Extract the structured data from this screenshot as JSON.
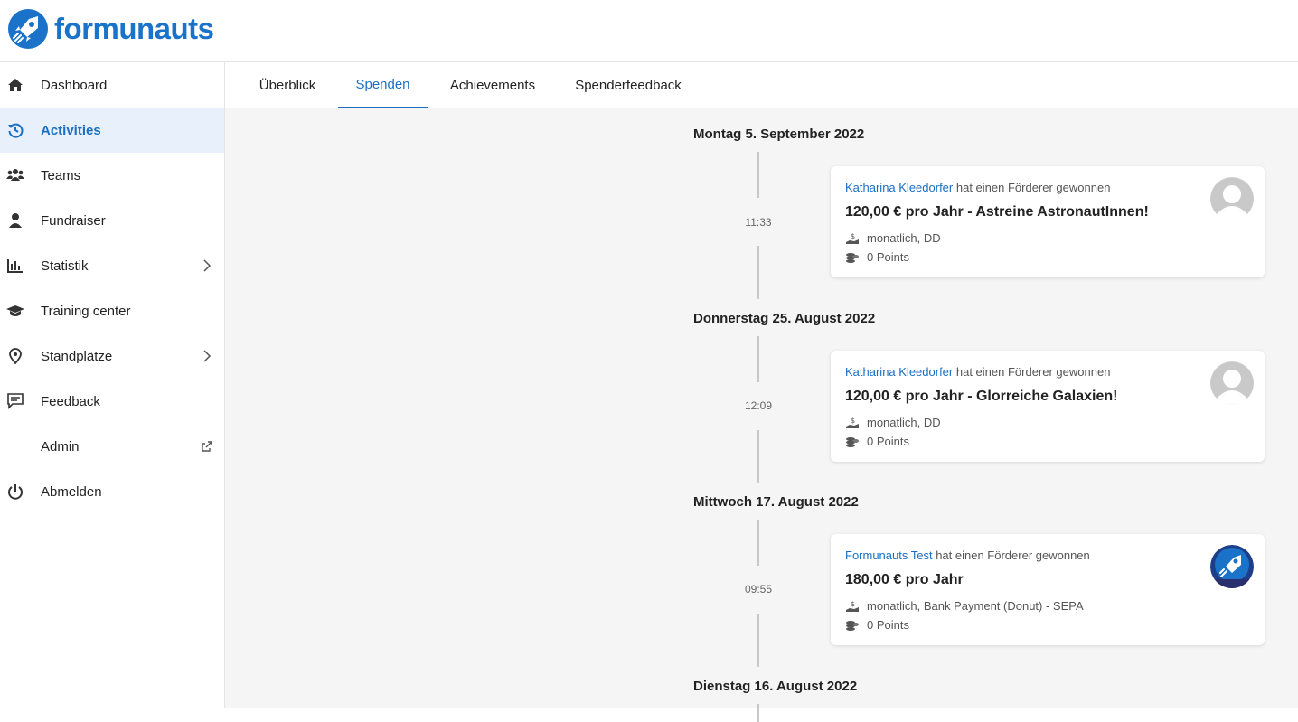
{
  "brand": {
    "name": "formunauts",
    "accent": "#1a73c9"
  },
  "sidebar": {
    "items": [
      {
        "label": "Dashboard",
        "icon": "home-icon",
        "active": false
      },
      {
        "label": "Activities",
        "icon": "history-icon",
        "active": true
      },
      {
        "label": "Teams",
        "icon": "users-icon",
        "active": false
      },
      {
        "label": "Fundraiser",
        "icon": "user-icon",
        "active": false
      },
      {
        "label": "Statistik",
        "icon": "chart-icon",
        "active": false,
        "chevron": true
      },
      {
        "label": "Training center",
        "icon": "graduation-cap-icon",
        "active": false
      },
      {
        "label": "Standplätze",
        "icon": "map-pin-icon",
        "active": false,
        "chevron": true
      },
      {
        "label": "Feedback",
        "icon": "comment-icon",
        "active": false
      },
      {
        "label": "Admin",
        "icon": "",
        "active": false,
        "external": true
      },
      {
        "label": "Abmelden",
        "icon": "power-icon",
        "active": false
      }
    ]
  },
  "tabs": [
    {
      "label": "Überblick",
      "active": false
    },
    {
      "label": "Spenden",
      "active": true
    },
    {
      "label": "Achievements",
      "active": false
    },
    {
      "label": "Spenderfeedback",
      "active": false
    }
  ],
  "timeline": [
    {
      "date": "Montag 5. September 2022",
      "time": "11:33",
      "who": "Katharina Kleedorfer",
      "action": " hat einen Förderer gewonnen",
      "title": "120,00 € pro Jahr - Astreine AstronautInnen!",
      "payment": "monatlich, DD",
      "points": "0 Points",
      "avatar": "default"
    },
    {
      "date": "Donnerstag 25. August 2022",
      "time": "12:09",
      "who": "Katharina Kleedorfer",
      "action": " hat einen Förderer gewonnen",
      "title": "120,00 € pro Jahr - Glorreiche Galaxien!",
      "payment": "monatlich, DD",
      "points": "0 Points",
      "avatar": "default"
    },
    {
      "date": "Mittwoch 17. August 2022",
      "time": "09:55",
      "who": "Formunauts Test",
      "action": " hat einen Förderer gewonnen",
      "title": "180,00 € pro Jahr",
      "payment": "monatlich, Bank Payment (Donut) - SEPA",
      "points": "0 Points",
      "avatar": "logo"
    }
  ],
  "next_date": "Dienstag 16. August 2022"
}
